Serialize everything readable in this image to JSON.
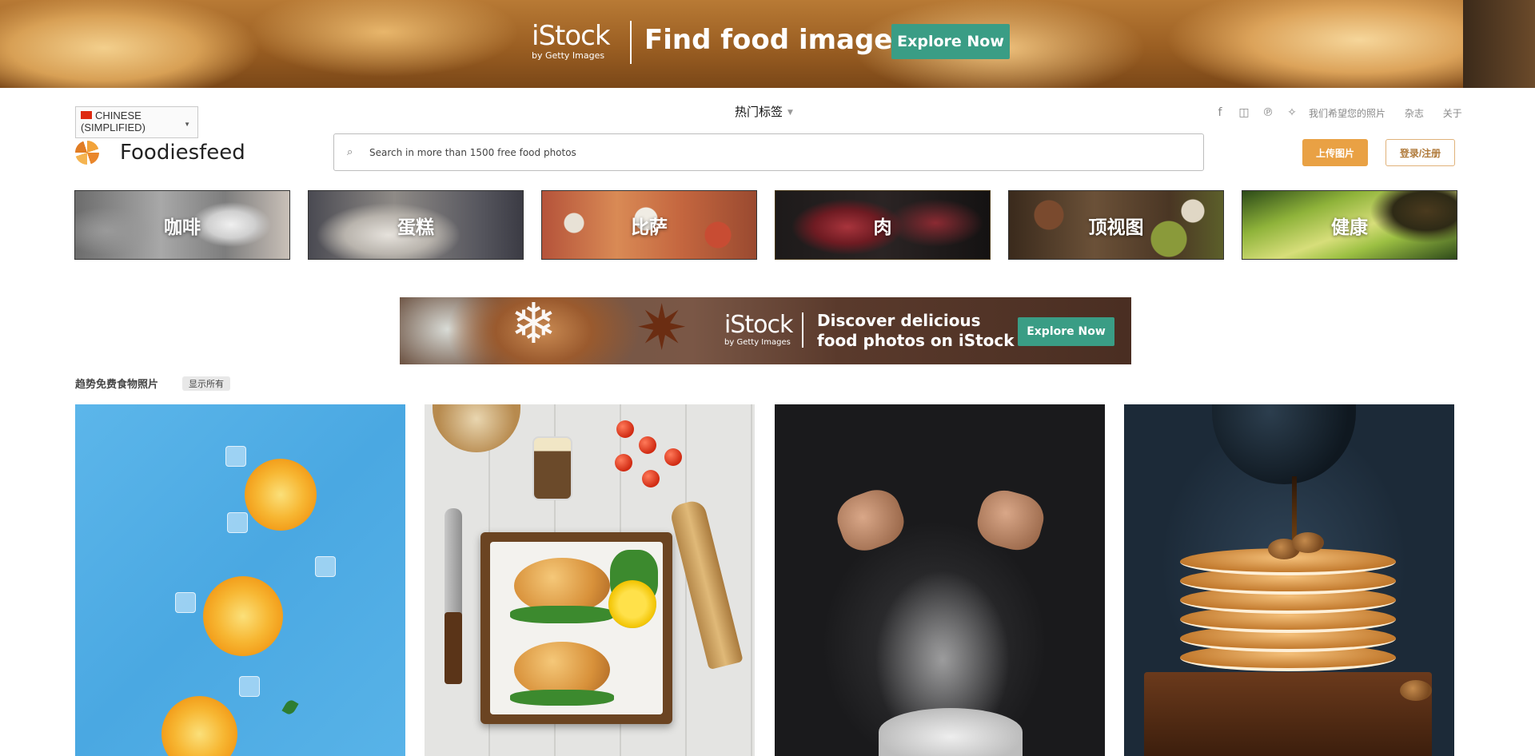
{
  "top_banner": {
    "brand": "iStock",
    "brand_sub": "by Getty Images",
    "headline": "Find food images",
    "cta": "Explore Now"
  },
  "header": {
    "language": "CHINESE (SIMPLIFIED)",
    "hot_tags": "热门标签",
    "social_icons": [
      "facebook-icon",
      "instagram-icon",
      "pinterest-icon",
      "twitter-icon"
    ],
    "links": [
      "我们希望您的照片",
      "杂志",
      "关于"
    ],
    "brand": "Foodiesfeed",
    "search_placeholder": "Search in more than 1500 free food photos",
    "upload_label": "上传图片",
    "login_label": "登录/注册"
  },
  "categories": [
    "咖啡",
    "蛋糕",
    "比萨",
    "肉",
    "顶视图",
    "健康"
  ],
  "mid_banner": {
    "brand": "iStock",
    "brand_sub": "by Getty Images",
    "headline_line1": "Discover delicious",
    "headline_line2": "food photos on iStock",
    "cta": "Explore Now"
  },
  "section": {
    "title": "趋势免费食物照片",
    "show_all": "显示所有"
  },
  "colors": {
    "accent_orange": "#e9a144",
    "istock_green": "#3a9d85"
  }
}
